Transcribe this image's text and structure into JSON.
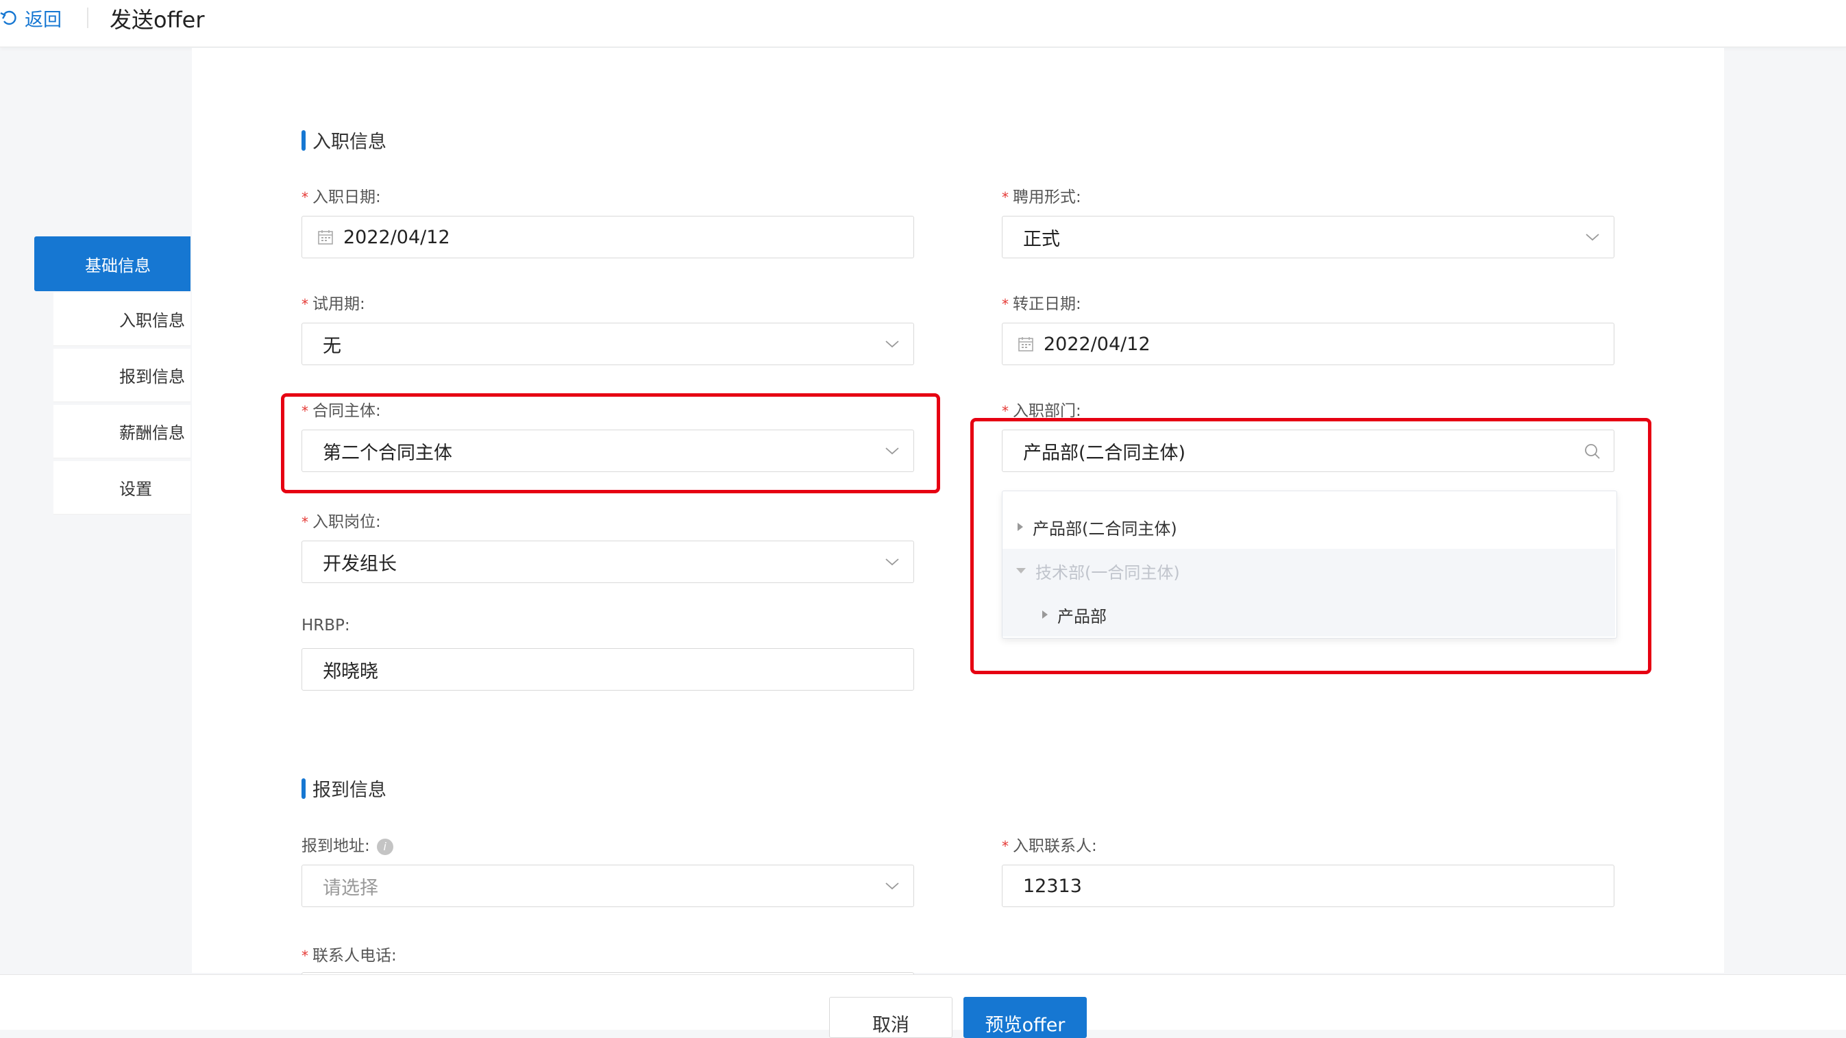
{
  "header": {
    "back_label": "返回",
    "title": "发送offer"
  },
  "sidebar": {
    "items": [
      {
        "label": "基础信息",
        "active": true
      },
      {
        "label": "入职信息",
        "active": false
      },
      {
        "label": "报到信息",
        "active": false
      },
      {
        "label": "薪酬信息",
        "active": false
      },
      {
        "label": "设置",
        "active": false
      }
    ]
  },
  "onboarding": {
    "section_title": "入职信息",
    "start_date": {
      "label": "入职日期:",
      "value": "2022/04/12"
    },
    "employment_type": {
      "label": "聘用形式:",
      "value": "正式"
    },
    "probation": {
      "label": "试用期:",
      "value": "无"
    },
    "regularization_date": {
      "label": "转正日期:",
      "value": "2022/04/12"
    },
    "contract_entity": {
      "label": "合同主体:",
      "value": "第二个合同主体"
    },
    "department": {
      "label": "入职部门:",
      "value": "产品部(二合同主体)",
      "tree_options": [
        {
          "label": "产品部(二合同主体)"
        },
        {
          "label": "技术部(一合同主体)"
        },
        {
          "label": "产品部"
        }
      ]
    },
    "position": {
      "label": "入职岗位:",
      "value": "开发组长"
    },
    "hrbp": {
      "label": "HRBP:",
      "value": "郑晓晓"
    }
  },
  "report": {
    "section_title": "报到信息",
    "address": {
      "label": "报到地址:",
      "placeholder": "请选择",
      "info_glyph": "i"
    },
    "contact": {
      "label": "入职联系人:",
      "value": "12313"
    },
    "contact_phone": {
      "label": "联系人电话:"
    }
  },
  "footer": {
    "cancel_label": "取消",
    "preview_label": "预览offer"
  },
  "colors": {
    "accent": "#1677d2",
    "highlight": "#e60012",
    "required": "#e53935"
  }
}
